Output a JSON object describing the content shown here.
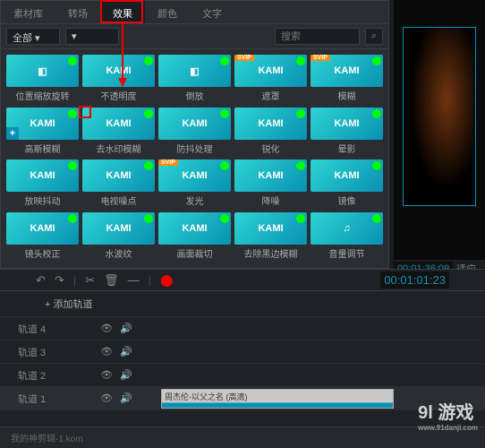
{
  "tabs": [
    "素材库",
    "转场",
    "效果",
    "颜色",
    "文字"
  ],
  "active_tab": 2,
  "filter": {
    "dropdown": "全部",
    "search_placeholder": "搜索"
  },
  "effects": [
    {
      "label": "位置缩放旋转",
      "svip": false,
      "alt": true
    },
    {
      "label": "不透明度",
      "svip": false
    },
    {
      "label": "倒放",
      "svip": false,
      "alt": true
    },
    {
      "label": "遮罩",
      "svip": true
    },
    {
      "label": "模糊",
      "svip": true
    },
    {
      "label": "高斯模糊",
      "svip": false,
      "plus": true
    },
    {
      "label": "去水印模糊",
      "svip": false
    },
    {
      "label": "防抖处理",
      "svip": false
    },
    {
      "label": "锐化",
      "svip": false
    },
    {
      "label": "晕影",
      "svip": false
    },
    {
      "label": "放映抖动",
      "svip": false
    },
    {
      "label": "电视噪点",
      "svip": false
    },
    {
      "label": "发光",
      "svip": true
    },
    {
      "label": "降噪",
      "svip": false
    },
    {
      "label": "镜像",
      "svip": false
    },
    {
      "label": "镜头校正",
      "svip": false
    },
    {
      "label": "水波纹",
      "svip": false
    },
    {
      "label": "画面裁切",
      "svip": false
    },
    {
      "label": "去除黑边模糊",
      "svip": false
    },
    {
      "label": "音量调节",
      "svip": false,
      "music": true
    }
  ],
  "timecode": "00:01:36:09",
  "timecode2": "00:01:01:23",
  "side_label": "适应",
  "toolbar_icons": [
    "undo-icon",
    "redo-icon",
    "cut-icon",
    "trash-icon",
    "slider-icon",
    "marker-icon"
  ],
  "add_track_label": "+ 添加轨道",
  "tracks": [
    {
      "name": "轨道 4"
    },
    {
      "name": "轨道 3"
    },
    {
      "name": "轨道 2"
    },
    {
      "name": "轨道 1",
      "selected": true,
      "clip": "周杰伦-以父之名 (高清)"
    }
  ],
  "filename": "我的神剪辑-1.kom",
  "watermark": {
    "brand": "9l 游戏",
    "url": "www.91danji.com"
  },
  "svip_tag": "SVIP",
  "thumb_text": "KAMI"
}
